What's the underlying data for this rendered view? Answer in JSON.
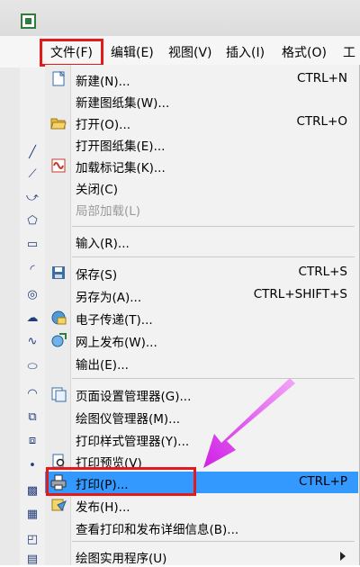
{
  "menubar": {
    "items": [
      "文件(F)",
      "编辑(E)",
      "视图(V)",
      "插入(I)",
      "格式(O)",
      "工"
    ]
  },
  "file_menu": {
    "items": [
      {
        "label": "新建(N)...",
        "shortcut": "CTRL+N",
        "icon": "new-file-icon"
      },
      {
        "label": "新建图纸集(W)...",
        "shortcut": ""
      },
      {
        "label": "打开(O)...",
        "shortcut": "CTRL+O",
        "icon": "open-folder-icon"
      },
      {
        "label": "打开图纸集(E)...",
        "shortcut": ""
      },
      {
        "label": "加载标记集(K)...",
        "shortcut": "",
        "icon": "markup-set-icon"
      },
      {
        "label": "关闭(C)",
        "shortcut": ""
      },
      {
        "label": "局部加载(L)",
        "shortcut": "",
        "disabled": true
      },
      {
        "label": "输入(R)...",
        "shortcut": ""
      },
      {
        "label": "保存(S)",
        "shortcut": "CTRL+S",
        "icon": "save-icon"
      },
      {
        "label": "另存为(A)...",
        "shortcut": "CTRL+SHIFT+S"
      },
      {
        "label": "电子传递(T)...",
        "shortcut": "",
        "icon": "etransmit-icon"
      },
      {
        "label": "网上发布(W)...",
        "shortcut": "",
        "icon": "publish-web-icon"
      },
      {
        "label": "输出(E)...",
        "shortcut": ""
      },
      {
        "label": "页面设置管理器(G)...",
        "shortcut": "",
        "icon": "page-setup-icon"
      },
      {
        "label": "绘图仪管理器(M)...",
        "shortcut": ""
      },
      {
        "label": "打印样式管理器(Y)...",
        "shortcut": ""
      },
      {
        "label": "打印预览(V)",
        "shortcut": "",
        "icon": "print-preview-icon"
      },
      {
        "label": "打印(P)...",
        "shortcut": "CTRL+P",
        "icon": "print-icon"
      },
      {
        "label": "发布(H)...",
        "shortcut": "",
        "icon": "publish-icon"
      },
      {
        "label": "查看打印和发布详细信息(B)...",
        "shortcut": ""
      },
      {
        "label": "绘图实用程序(U)",
        "shortcut": ""
      }
    ]
  },
  "colors": {
    "highlight": "#3399ff",
    "annotation_red": "#e21a1a",
    "annotation_arrow": "#e040fb"
  }
}
